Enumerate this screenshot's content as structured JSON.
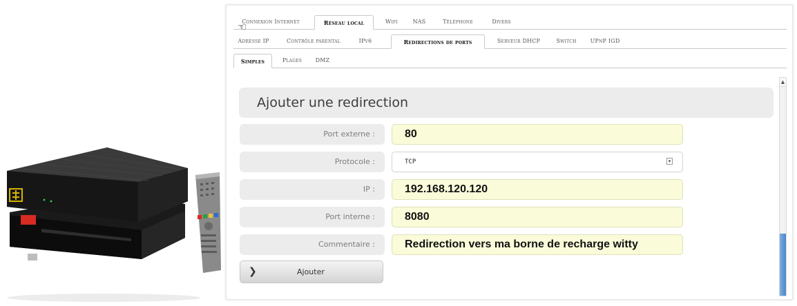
{
  "nav": {
    "tabs_row1": [
      {
        "label": "Connexion Internet",
        "active": false
      },
      {
        "label": "Réseau local",
        "active": true
      },
      {
        "label": "Wifi",
        "active": false
      },
      {
        "label": "NAS",
        "active": false
      },
      {
        "label": "Téléphone",
        "active": false
      },
      {
        "label": "Divers",
        "active": false
      }
    ],
    "tabs_row2": [
      {
        "label": "Adresse IP",
        "active": false
      },
      {
        "label": "Contrôle parental",
        "active": false
      },
      {
        "label": "IPv6",
        "active": false
      },
      {
        "label": "Redirections de ports",
        "active": true
      },
      {
        "label": "Serveur DHCP",
        "active": false
      },
      {
        "label": "Switch",
        "active": false
      },
      {
        "label": "UPnP IGD",
        "active": false
      }
    ],
    "tabs_row3": [
      {
        "label": "Simples",
        "active": true
      },
      {
        "label": "Plages",
        "active": false
      },
      {
        "label": "DMZ",
        "active": false
      }
    ]
  },
  "form": {
    "title": "Ajouter une redirection",
    "fields": {
      "port_externe": {
        "label": "Port externe :",
        "value": "80"
      },
      "protocole": {
        "label": "Protocole :",
        "value": "TCP"
      },
      "ip": {
        "label": "IP :",
        "value": "192.168.120.120"
      },
      "port_interne": {
        "label": "Port interne :",
        "value": "8080"
      },
      "commentaire": {
        "label": "Commentaire :",
        "value": "Redirection vers ma borne de recharge witty"
      }
    },
    "submit_label": "Ajouter"
  },
  "icons": {
    "cursor": "pointer-cursor-icon",
    "select_arrow": "dropdown-arrow-icon",
    "button_chevron": "chevron-right-icon",
    "scroll_up": "scroll-up-arrow-icon"
  },
  "colors": {
    "input_background": "#fafbd9",
    "label_background": "#ececec",
    "scrollbar_thumb": "#4a86c9"
  }
}
